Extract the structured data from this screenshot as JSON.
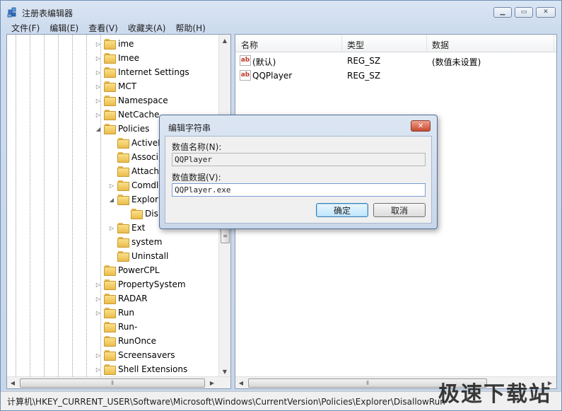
{
  "window": {
    "title": "注册表编辑器",
    "icon": "registry-editor-icon",
    "caption_buttons": [
      "minimize",
      "maximize",
      "close"
    ]
  },
  "menu": [
    "文件(F)",
    "编辑(E)",
    "查看(V)",
    "收藏夹(A)",
    "帮助(H)"
  ],
  "tree": {
    "items": [
      {
        "label": "ime",
        "level": 0,
        "expander": "collapsed"
      },
      {
        "label": "Imee",
        "level": 0,
        "expander": "collapsed"
      },
      {
        "label": "Internet Settings",
        "level": 0,
        "expander": "collapsed"
      },
      {
        "label": "MCT",
        "level": 0,
        "expander": "collapsed"
      },
      {
        "label": "Namespace",
        "level": 0,
        "expander": "collapsed"
      },
      {
        "label": "NetCache",
        "level": 0,
        "expander": "collapsed"
      },
      {
        "label": "Policies",
        "level": 0,
        "expander": "expanded"
      },
      {
        "label": "ActiveD",
        "level": 1,
        "expander": "none"
      },
      {
        "label": "Associ",
        "level": 1,
        "expander": "none"
      },
      {
        "label": "Attachi",
        "level": 1,
        "expander": "none"
      },
      {
        "label": "Comdl",
        "level": 1,
        "expander": "collapsed"
      },
      {
        "label": "Explor",
        "level": 1,
        "expander": "expanded"
      },
      {
        "label": "Dis",
        "level": 2,
        "expander": "none"
      },
      {
        "label": "Ext",
        "level": 1,
        "expander": "collapsed"
      },
      {
        "label": "system",
        "level": 1,
        "expander": "none"
      },
      {
        "label": "Uninstall",
        "level": 1,
        "expander": "none"
      },
      {
        "label": "PowerCPL",
        "level": 0,
        "expander": "none"
      },
      {
        "label": "PropertySystem",
        "level": 0,
        "expander": "collapsed"
      },
      {
        "label": "RADAR",
        "level": 0,
        "expander": "collapsed"
      },
      {
        "label": "Run",
        "level": 0,
        "expander": "collapsed"
      },
      {
        "label": "Run-",
        "level": 0,
        "expander": "none"
      },
      {
        "label": "RunOnce",
        "level": 0,
        "expander": "none"
      },
      {
        "label": "Screensavers",
        "level": 0,
        "expander": "collapsed"
      },
      {
        "label": "Shell Extensions",
        "level": 0,
        "expander": "collapsed"
      }
    ]
  },
  "list": {
    "columns": [
      "名称",
      "类型",
      "数据"
    ],
    "rows": [
      {
        "name": "(默认)",
        "type": "REG_SZ",
        "data": "(数值未设置)",
        "icon": "string-value-icon"
      },
      {
        "name": "QQPlayer",
        "type": "REG_SZ",
        "data": "",
        "icon": "string-value-icon"
      }
    ]
  },
  "dialog": {
    "title": "编辑字符串",
    "name_label": "数值名称(N):",
    "name_value": "QQPlayer",
    "data_label": "数值数据(V):",
    "data_value": "QQPlayer.exe",
    "ok_label": "确定",
    "cancel_label": "取消"
  },
  "status": {
    "path": "计算机\\HKEY_CURRENT_USER\\Software\\Microsoft\\Windows\\CurrentVersion\\Policies\\Explorer\\DisallowRun"
  },
  "watermark": "极速下载站"
}
